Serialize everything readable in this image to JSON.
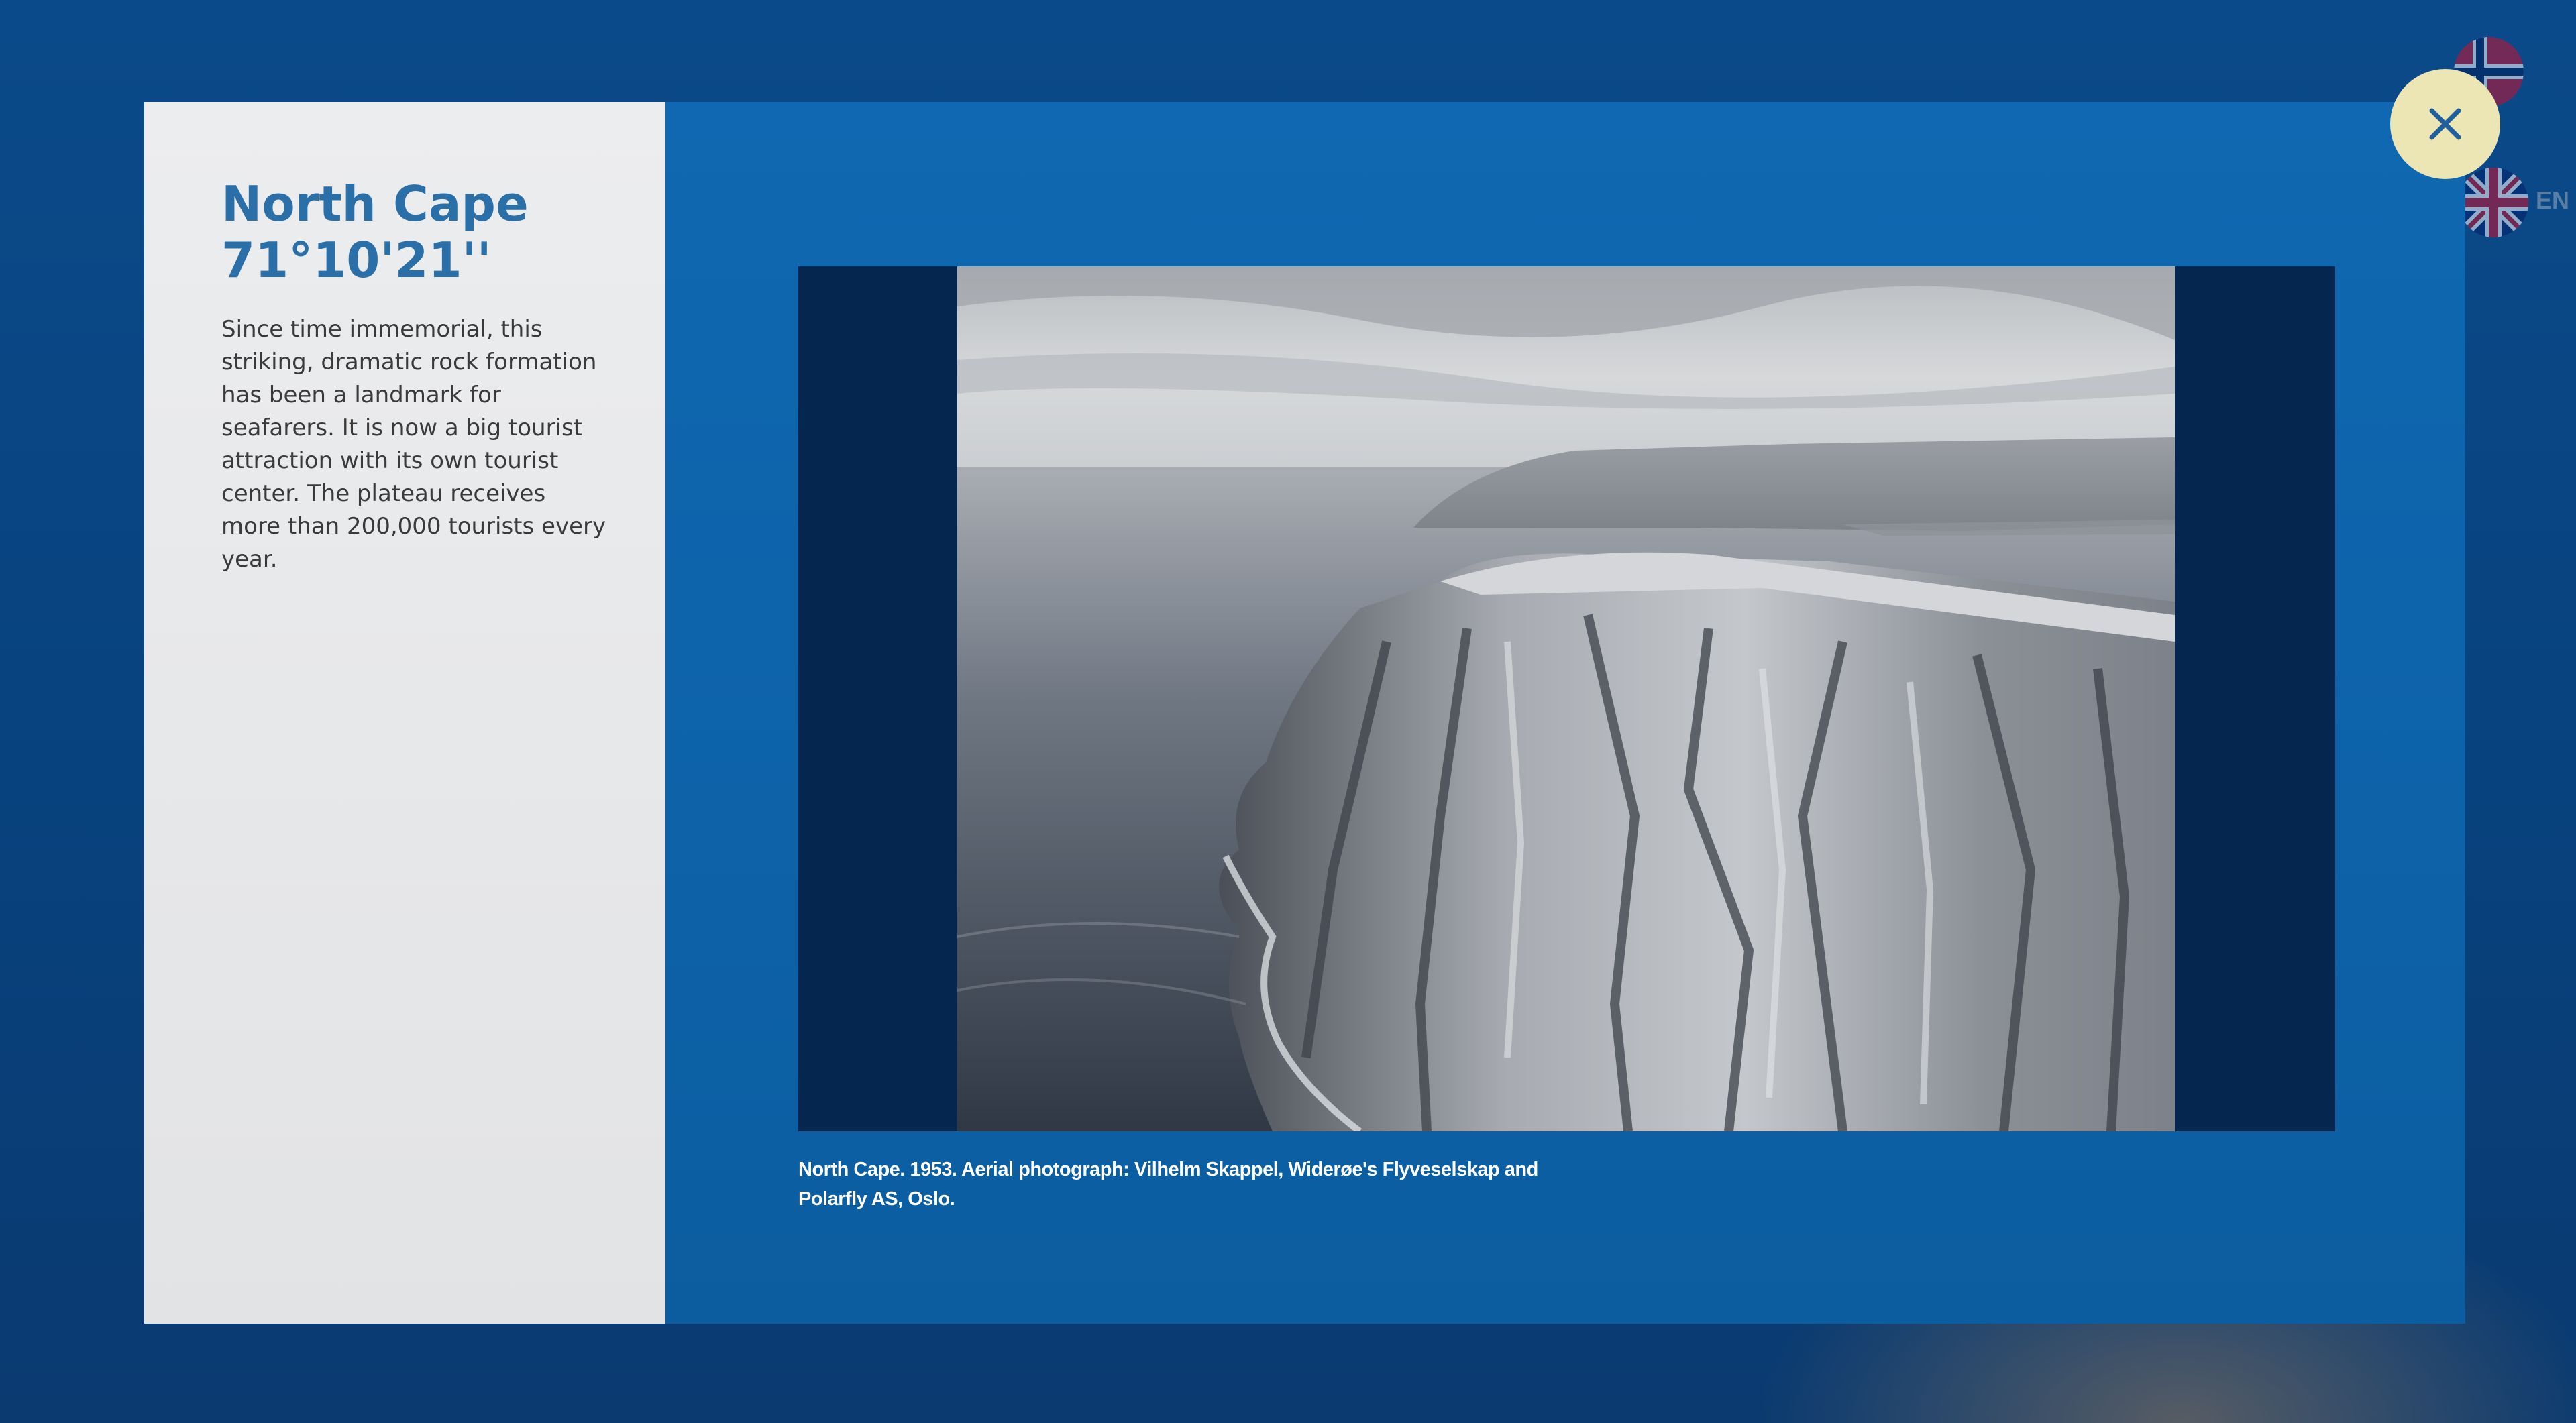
{
  "panel": {
    "title_line1": "North Cape",
    "title_line2": "71°10'21''",
    "description": "Since time immemorial, this striking, dramatic rock formation has been a landmark for seafarers. It is now a big tourist attraction with its own tourist center. The plateau receives more than 200,000 tourists every year."
  },
  "photo": {
    "caption": "North Cape. 1953. Aerial photograph: Vilhelm Skappel, Widerøe's Flyveselskap and Polarfly AS, Oslo."
  },
  "controls": {
    "close_icon": "close-icon",
    "language_label": "EN",
    "languages": [
      "norwegian-flag-icon",
      "uk-flag-icon"
    ]
  },
  "colors": {
    "background": "#0a3f78",
    "modal": "#0f68b1",
    "side_panel": "#ecedee",
    "title": "#2a6fa8",
    "photo_frame": "#04264f",
    "close_button": "#ebe6b4",
    "close_icon": "#1f5f9c"
  }
}
